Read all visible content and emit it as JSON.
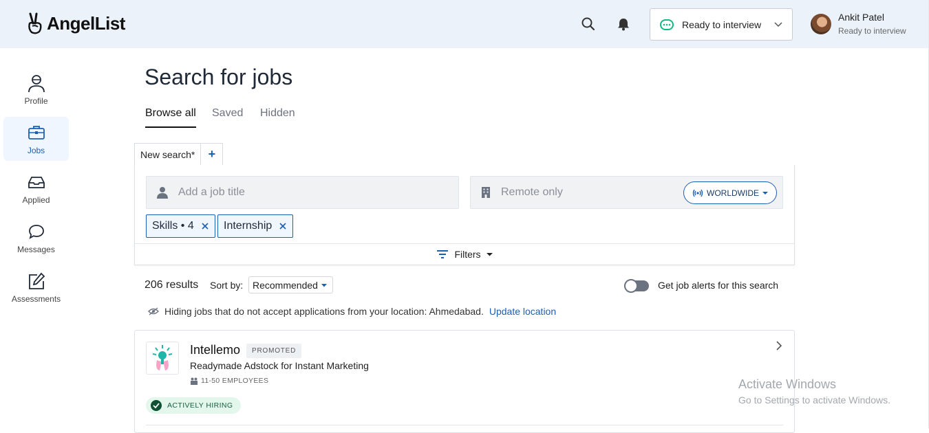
{
  "brand": {
    "name": "AngelList"
  },
  "header": {
    "status_label": "Ready to interview",
    "user_name": "Ankit Patel",
    "user_status": "Ready to interview"
  },
  "sidebar": {
    "items": [
      {
        "label": "Profile",
        "icon": "profile-icon"
      },
      {
        "label": "Jobs",
        "icon": "briefcase-icon",
        "active": true
      },
      {
        "label": "Applied",
        "icon": "inbox-icon"
      },
      {
        "label": "Messages",
        "icon": "chat-icon"
      },
      {
        "label": "Assessments",
        "icon": "edit-icon"
      }
    ]
  },
  "main": {
    "title": "Search for jobs",
    "tabs": [
      {
        "label": "Browse all",
        "active": true
      },
      {
        "label": "Saved"
      },
      {
        "label": "Hidden"
      }
    ],
    "search_tab": {
      "label": "New search*",
      "add": "+"
    },
    "job_title_placeholder": "Add a job title",
    "location_placeholder": "Remote only",
    "worldwide_label": "WORLDWIDE",
    "chips": [
      {
        "label": "Skills • 4"
      },
      {
        "label": "Internship"
      }
    ],
    "filters_label": "Filters",
    "results_count": "206 results",
    "sort_label": "Sort by:",
    "sort_value": "Recommended",
    "alerts_label": "Get job alerts for this search",
    "alerts_enabled": false,
    "hide_note": "Hiding jobs that do not accept applications from your location: Ahmedabad.",
    "update_location": "Update location"
  },
  "listing": {
    "company": "Intellemo",
    "badge": "PROMOTED",
    "tagline": "Readymade Adstock for Instant Marketing",
    "size": "11-50 EMPLOYEES",
    "hiring": "ACTIVELY HIRING"
  },
  "watermark": {
    "line1": "Activate Windows",
    "line2": "Go to Settings to activate Windows."
  },
  "colors": {
    "accent": "#1a5fb4",
    "header_bg": "#ecf2fa",
    "status_green": "#10b981",
    "hiring_bg": "#e3f7ec"
  }
}
